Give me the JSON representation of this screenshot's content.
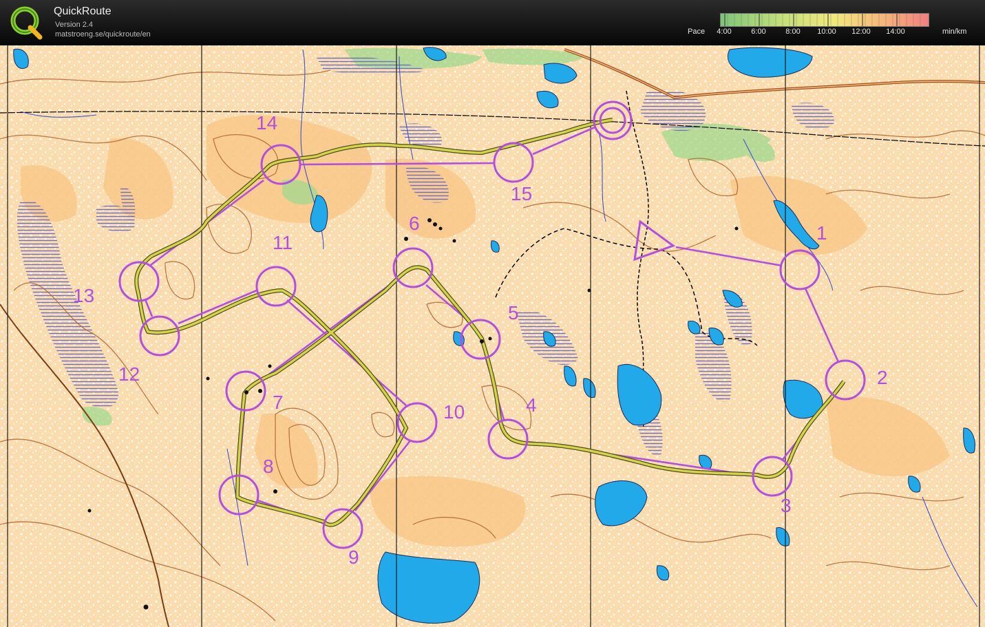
{
  "app": {
    "name": "QuickRoute",
    "version": "Version 2.4",
    "url": "matstroeng.se/quickroute/en"
  },
  "pace": {
    "label": "Pace",
    "ticks": [
      "4:00",
      "6:00",
      "8:00",
      "10:00",
      "12:00",
      "14:00"
    ],
    "unit": "min/km",
    "scale_colors": [
      "#7ec47a",
      "#c6e17a",
      "#f2e97c",
      "#f7b77b",
      "#ef7f7f"
    ]
  },
  "course": {
    "route_color": "#b34fe0",
    "gps_track_color": "#d4d34a",
    "controls": [
      "1",
      "2",
      "3",
      "4",
      "5",
      "6",
      "7",
      "8",
      "9",
      "10",
      "11",
      "12",
      "13",
      "14",
      "15"
    ]
  },
  "map_colors": {
    "open_land": "#f8c88a",
    "forest": "#ffffff",
    "water": "#22a9ea",
    "contour": "#b2642e",
    "green": "#9bd88d",
    "marsh": "#6a6cc8",
    "road": "#a05020"
  }
}
